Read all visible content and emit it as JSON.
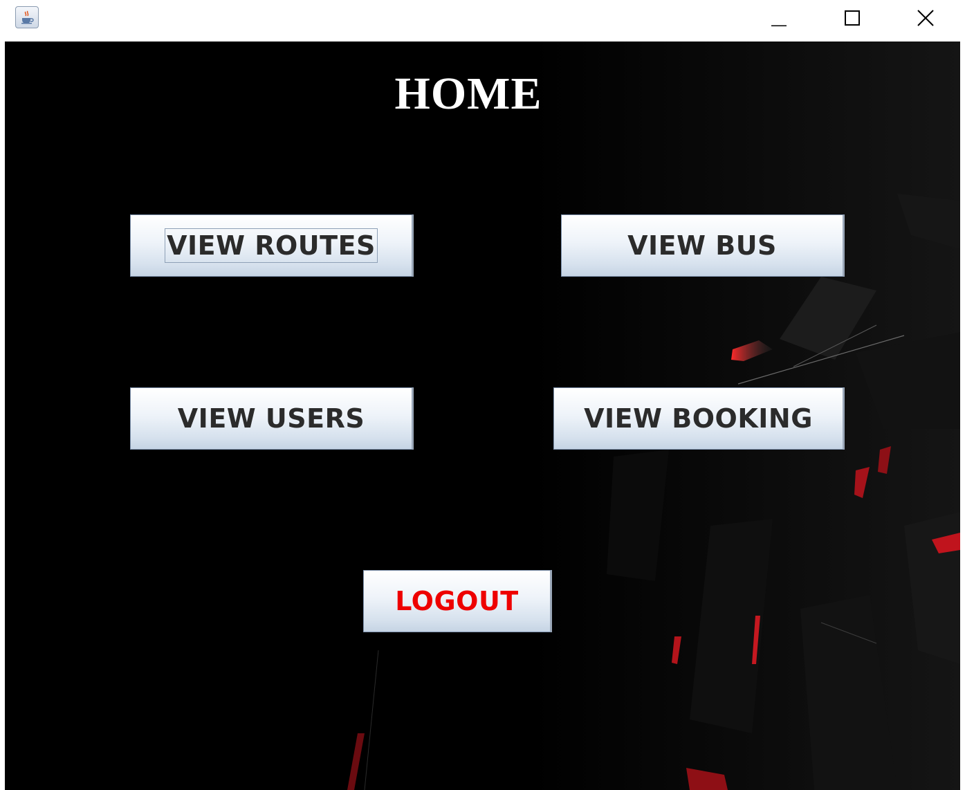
{
  "window": {
    "title": "",
    "icon": "java-cup-icon",
    "controls": {
      "minimize": "minimize-icon",
      "maximize": "maximize-icon",
      "close": "close-icon"
    }
  },
  "home": {
    "title": "HOME"
  },
  "buttons": {
    "view_routes": "VIEW ROUTES",
    "view_bus": "VIEW BUS",
    "view_users": "VIEW USERS",
    "view_booking": "VIEW BOOKING",
    "logout": "LOGOUT"
  },
  "colors": {
    "background": "#000000",
    "title_text": "#ffffff",
    "button_text": "#2b2b2b",
    "logout_text": "#ee0000",
    "accent_red": "#e0141e"
  }
}
